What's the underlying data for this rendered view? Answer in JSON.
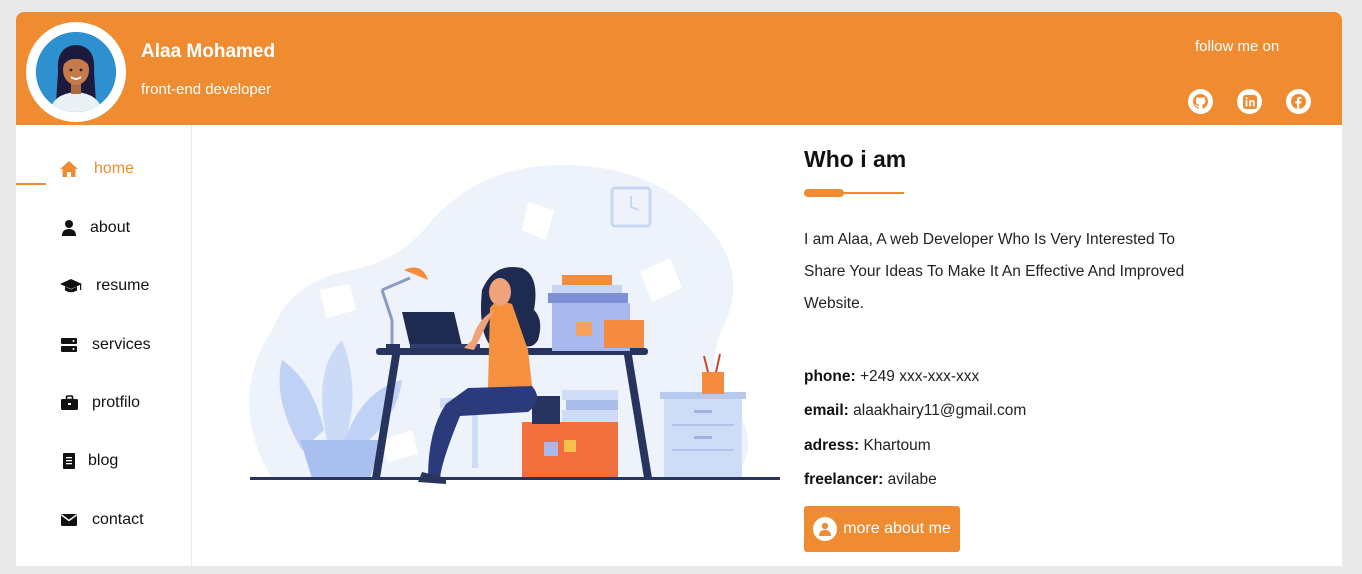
{
  "header": {
    "name": "Alaa Mohamed",
    "role": "front-end developer",
    "follow_label": "follow me on",
    "social": [
      {
        "icon": "github-icon"
      },
      {
        "icon": "linkedin-icon"
      },
      {
        "icon": "facebook-icon"
      }
    ]
  },
  "nav": [
    {
      "label": "home",
      "icon": "home-icon",
      "active": true
    },
    {
      "label": "about",
      "icon": "user-icon",
      "active": false
    },
    {
      "label": "resume",
      "icon": "graduation-cap-icon",
      "active": false
    },
    {
      "label": "services",
      "icon": "server-icon",
      "active": false
    },
    {
      "label": "protfilo",
      "icon": "briefcase-icon",
      "active": false
    },
    {
      "label": "blog",
      "icon": "document-icon",
      "active": false
    },
    {
      "label": "contact",
      "icon": "envelope-icon",
      "active": false
    }
  ],
  "about": {
    "title": "Who i am",
    "bio": "I am Alaa, A web Developer Who Is Very Interested To Share Your Ideas To Make It An Effective And Improved Website.",
    "phone_label": "phone:",
    "phone": "+249 xxx-xxx-xxx",
    "email_label": "email:",
    "email": "alaakhairy11@gmail.com",
    "address_label": "adress:",
    "address": "Khartoum",
    "freelancer_label": "freelancer:",
    "freelancer": "avilabe",
    "button_label": "more about me"
  },
  "colors": {
    "accent": "#ef8c31",
    "background": "#e9e9e9"
  }
}
